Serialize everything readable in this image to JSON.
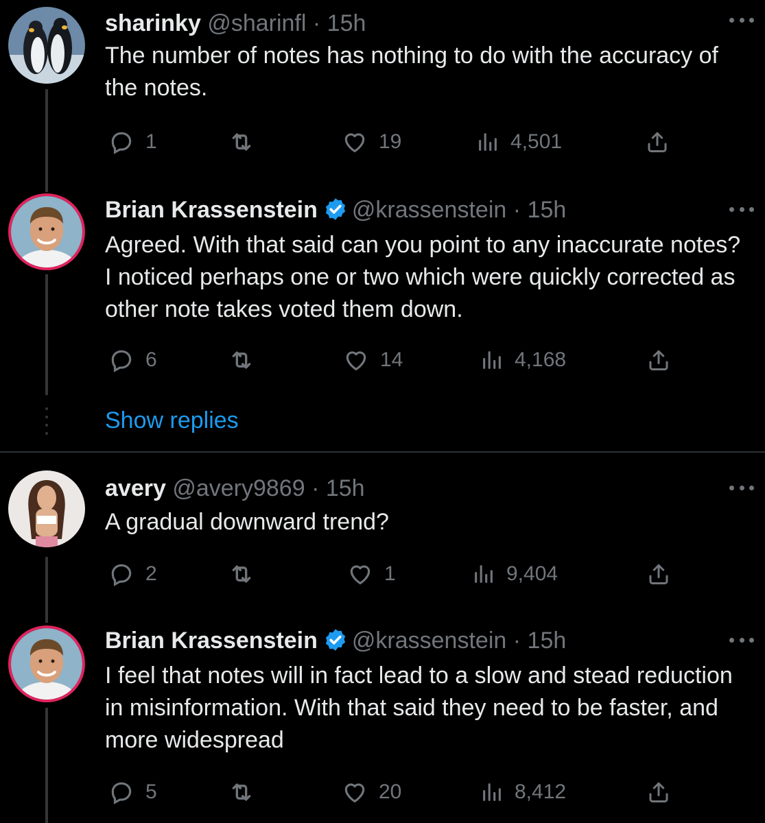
{
  "tweets": [
    {
      "name": "sharinky",
      "handle": "@sharinfl",
      "sep": "·",
      "time": "15h",
      "verified": false,
      "text": "The number of notes has nothing to do with the accuracy of the notes.",
      "stats": {
        "replies": "1",
        "retweets": "",
        "likes": "19",
        "views": "4,501"
      },
      "avatar": "penguins-avatar"
    },
    {
      "name": "Brian Krassenstein",
      "handle": "@krassenstein",
      "sep": "·",
      "time": "15h",
      "verified": true,
      "text": "Agreed.  With that said can you point to any inaccurate notes?  I noticed perhaps one or two which were quickly corrected as other note takes voted them down.",
      "stats": {
        "replies": "6",
        "retweets": "",
        "likes": "14",
        "views": "4,168"
      },
      "avatar": "man-avatar"
    },
    {
      "name": "avery",
      "handle": "@avery9869",
      "sep": "·",
      "time": "15h",
      "verified": false,
      "text": "A gradual downward trend?",
      "stats": {
        "replies": "2",
        "retweets": "",
        "likes": "1",
        "views": "9,404"
      },
      "avatar": "woman-avatar"
    },
    {
      "name": "Brian Krassenstein",
      "handle": "@krassenstein",
      "sep": "·",
      "time": "15h",
      "verified": true,
      "text": "I feel that notes will in fact lead to a slow and stead reduction in misinformation.  With that said they need to be faster, and more widespread",
      "stats": {
        "replies": "5",
        "retweets": "",
        "likes": "20",
        "views": "8,412"
      },
      "avatar": "man-avatar"
    }
  ],
  "show_replies": "Show replies",
  "colors": {
    "background": "#000000",
    "text": "#e7e9ea",
    "muted": "#71767b",
    "link": "#1d9bf0",
    "verified": "#1d9bf0",
    "avatar_ring": "#e0245e"
  }
}
